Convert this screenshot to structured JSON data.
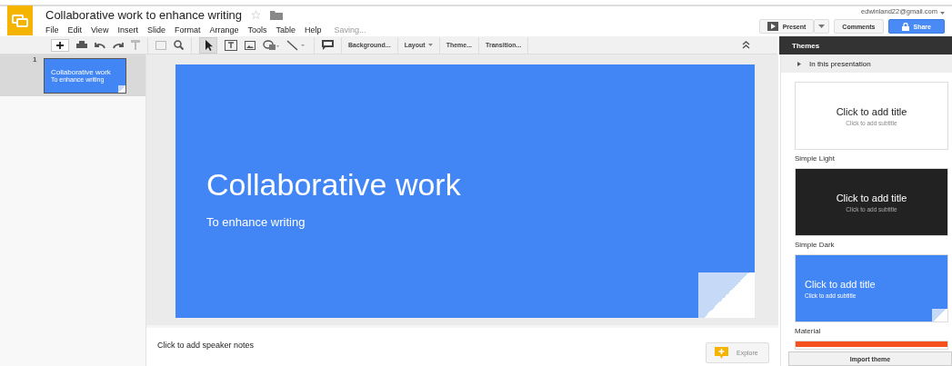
{
  "document": {
    "title": "Collaborative work to enhance writing",
    "starred": false,
    "status": "Saving..."
  },
  "menu": [
    "File",
    "Edit",
    "View",
    "Insert",
    "Slide",
    "Format",
    "Arrange",
    "Tools",
    "Table",
    "Help"
  ],
  "account": {
    "email": "edwinland22@gmail.com"
  },
  "actions": {
    "present": "Present",
    "comments": "Comments",
    "share": "Share"
  },
  "toolbar": [
    {
      "label": "Background...",
      "dropdown": false
    },
    {
      "label": "Layout",
      "dropdown": true
    },
    {
      "label": "Theme...",
      "dropdown": false
    },
    {
      "label": "Transition...",
      "dropdown": false
    }
  ],
  "filmstrip": [
    {
      "number": "1",
      "title": "Collaborative work",
      "subtitle": "To enhance writing",
      "selected": true
    }
  ],
  "slide": {
    "title": "Collaborative work",
    "subtitle": "To enhance writing"
  },
  "notes": {
    "placeholder": "Click to add speaker notes"
  },
  "explore": "Explore",
  "themes_panel": {
    "title": "Themes",
    "section": "In this presentation",
    "expanded": false,
    "themes": [
      {
        "kind": "light",
        "title": "Click to add title",
        "subtitle": "Click to add subtitle",
        "name": "Simple Light"
      },
      {
        "kind": "dark",
        "title": "Click to add title",
        "subtitle": "Click to add subtitle",
        "name": "Simple Dark"
      },
      {
        "kind": "material",
        "title": "Click to add title",
        "subtitle": "Click to add subtitle",
        "name": "Material"
      },
      {
        "kind": "orange"
      }
    ],
    "import": "Import theme"
  }
}
